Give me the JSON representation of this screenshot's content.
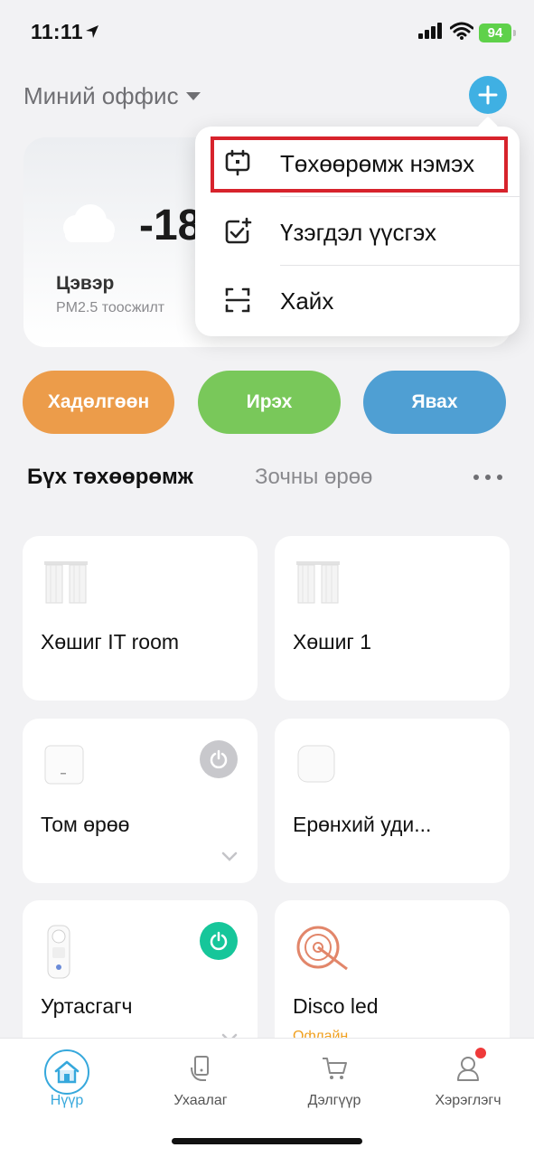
{
  "status_bar": {
    "time": "11:11",
    "battery": "94"
  },
  "header": {
    "home_name": "Миний оффис"
  },
  "weather": {
    "temperature": "-18",
    "air_quality": "Цэвэр",
    "air_label": "PM2.5 тоосжилт"
  },
  "scenes": [
    {
      "label": "Хадөлгөөн",
      "color": "#ec9c4a"
    },
    {
      "label": "Ирэх",
      "color": "#79c85a"
    },
    {
      "label": "Явах",
      "color": "#4f9fd3"
    }
  ],
  "tabs": [
    {
      "label": "Бүх төхөөрөмж"
    },
    {
      "label": "Зочны өрөө"
    }
  ],
  "devices": [
    {
      "name": "Хөшиг IT room"
    },
    {
      "name": "Хөшиг 1"
    },
    {
      "name": "Том өрөө"
    },
    {
      "name": "Ерөнхий уди..."
    },
    {
      "name": "Уртасгагч"
    },
    {
      "name": "Disco led",
      "status": "Офлайн"
    }
  ],
  "add_menu": {
    "items": [
      {
        "label": "Төхөөрөмж нэмэх",
        "icon": "add-device-icon"
      },
      {
        "label": "Үзэгдэл үүсгэх",
        "icon": "create-scene-icon"
      },
      {
        "label": "Хайх",
        "icon": "scan-icon"
      }
    ]
  },
  "bottom_nav": {
    "items": [
      {
        "label": "Нүүр",
        "icon": "home-icon"
      },
      {
        "label": "Ухаалаг",
        "icon": "smart-icon"
      },
      {
        "label": "Дэлгүүр",
        "icon": "cart-icon"
      },
      {
        "label": "Хэрэглэгч",
        "icon": "user-icon"
      }
    ]
  },
  "colors": {
    "accent": "#36a8dc",
    "power_on": "#16c69a",
    "highlight": "#d7232c",
    "offline": "#f0a020"
  }
}
